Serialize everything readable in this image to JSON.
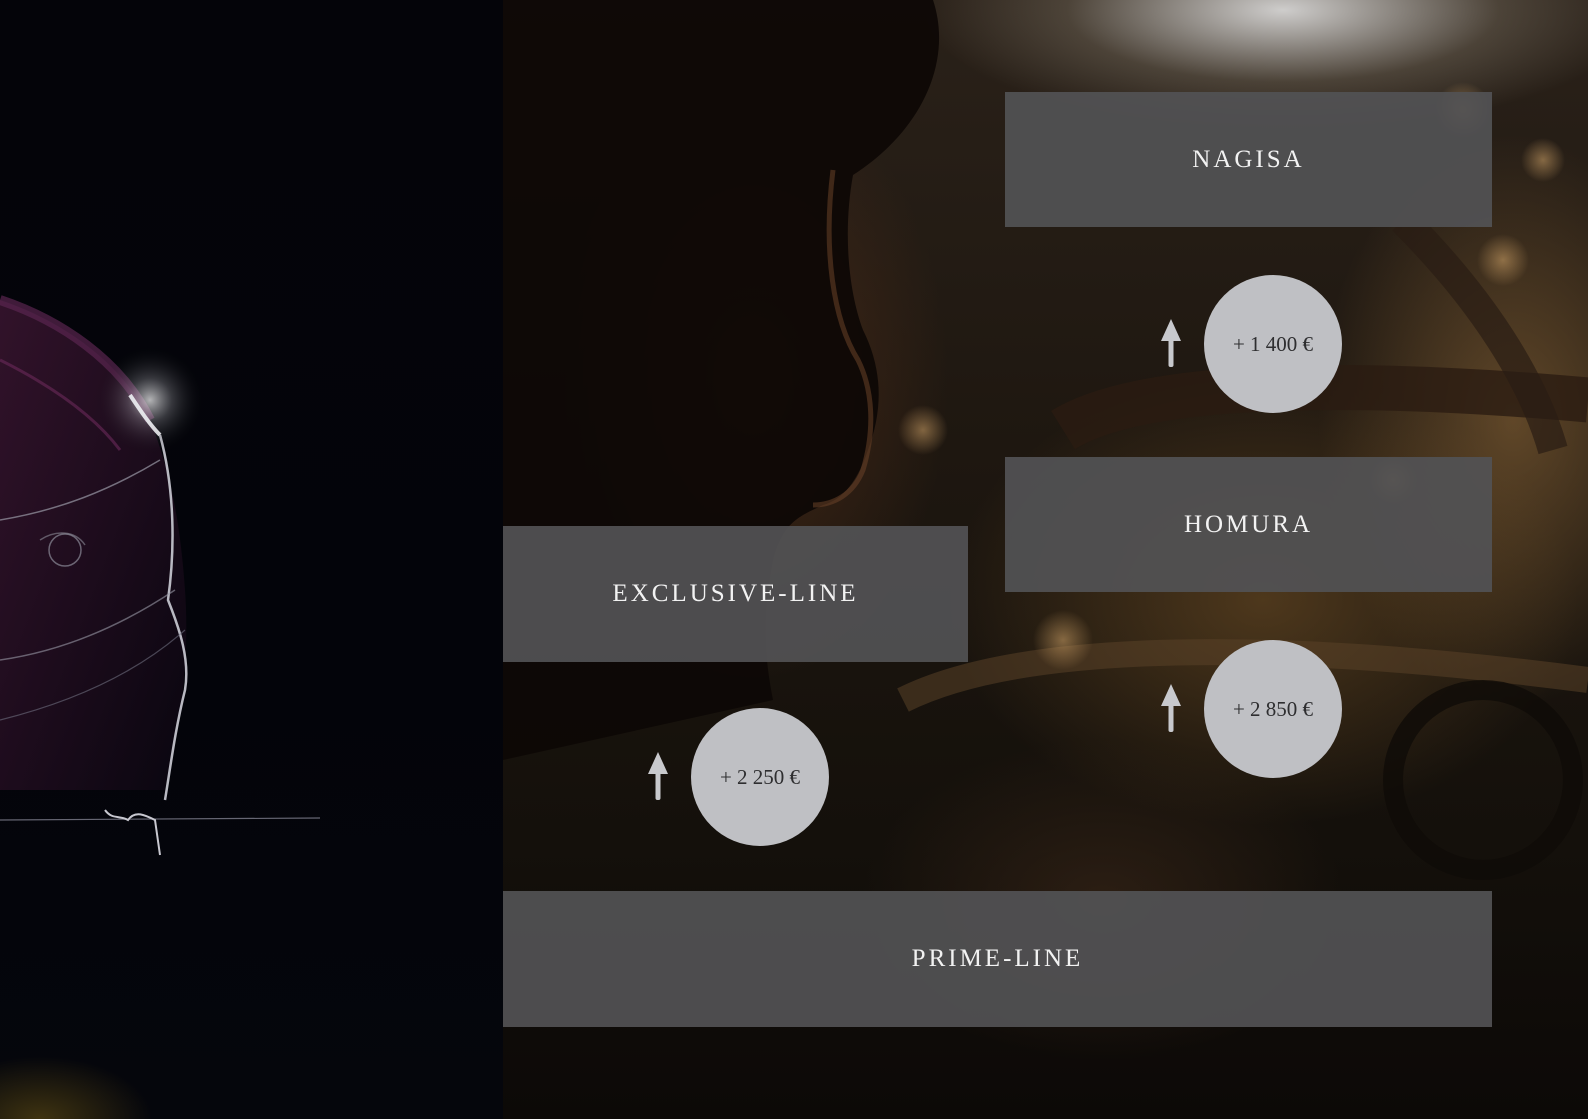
{
  "options": {
    "nagisa": {
      "label": "NAGISA"
    },
    "homura": {
      "label": "HOMURA"
    },
    "exclusive": {
      "label": "EXCLUSIVE-LINE"
    },
    "prime": {
      "label": "PRIME-LINE"
    }
  },
  "upgrades": {
    "to_nagisa": {
      "price": "+ 1 400 €",
      "icon": "arrow-up-icon"
    },
    "to_homura": {
      "price": "+ 2 850 €",
      "icon": "arrow-up-icon"
    },
    "to_exclusive": {
      "price": "+ 2 250 €",
      "icon": "arrow-up-icon"
    }
  },
  "colors": {
    "box": "#525254",
    "circle": "#bfc0c4",
    "label": "#f2f2f2",
    "price_text": "#2e2e30"
  }
}
